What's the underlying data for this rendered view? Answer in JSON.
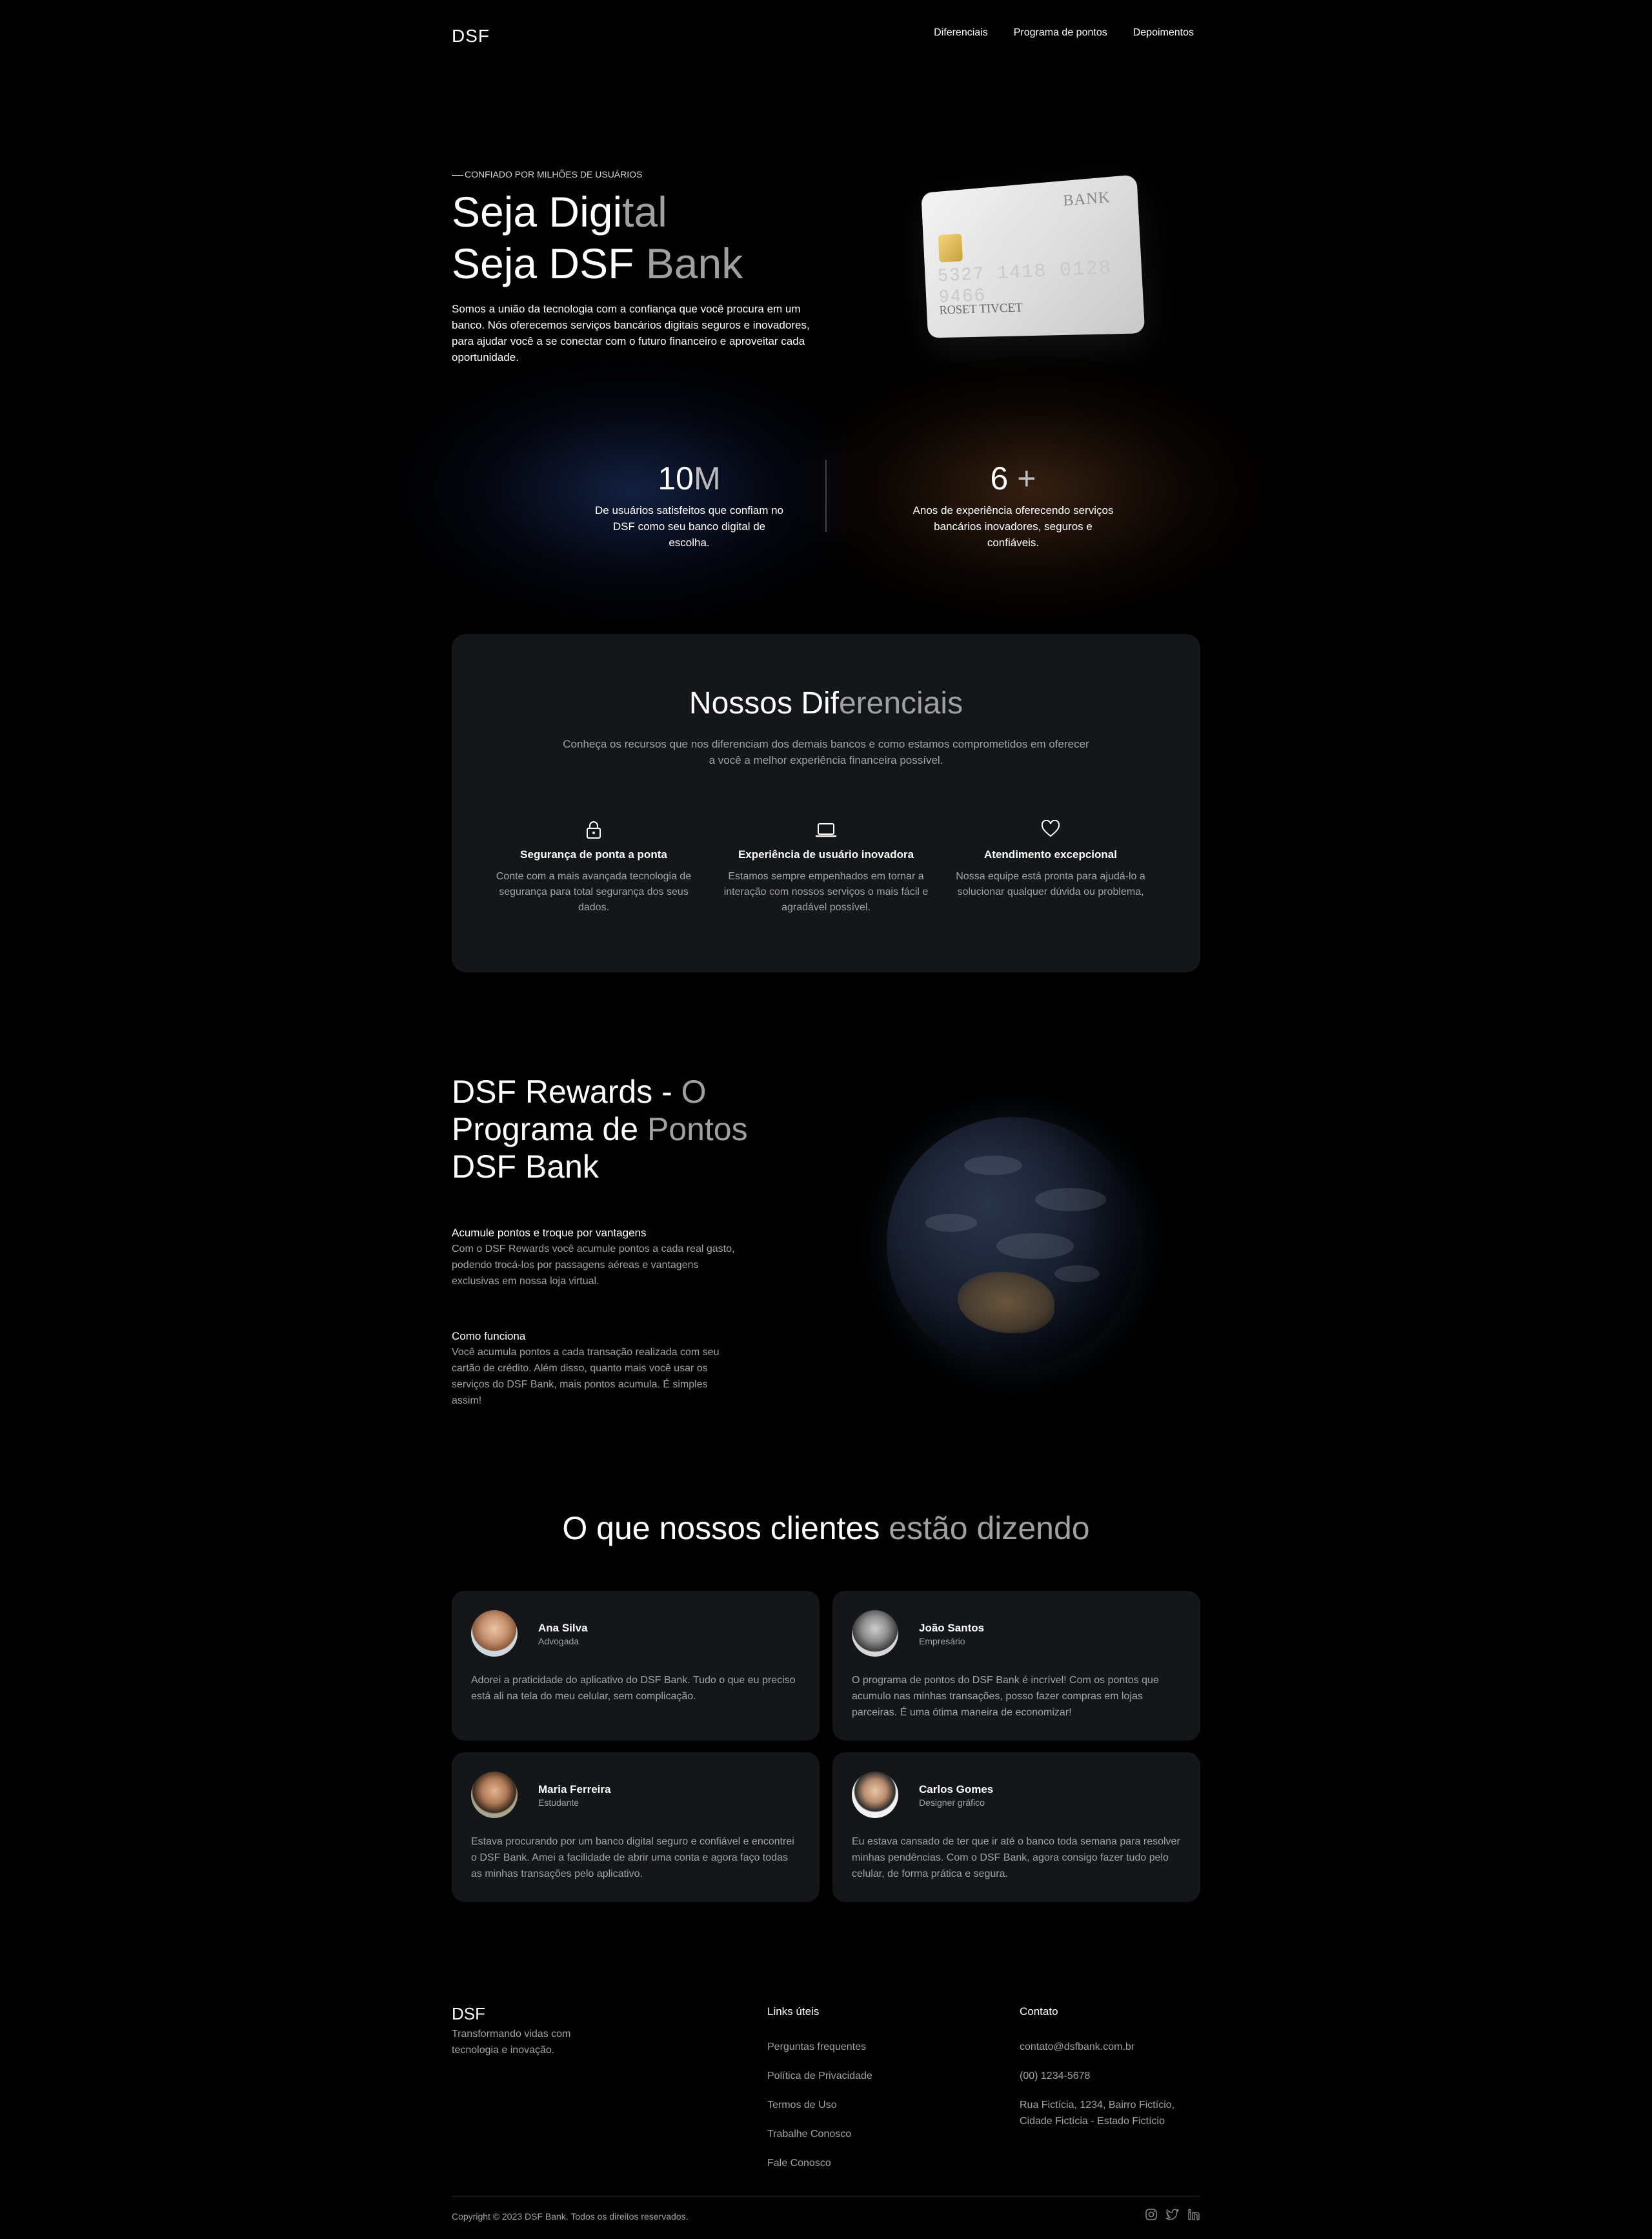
{
  "nav": {
    "logo": "DSF",
    "links": [
      "Diferenciais",
      "Programa de pontos",
      "Depoimentos"
    ]
  },
  "hero": {
    "eyebrow": "CONFIADO POR MILHÕES DE USUÁRIOS",
    "title_line1_a": "Seja Digi",
    "title_line1_b": "tal",
    "title_line2_a": "Seja DSF ",
    "title_line2_b": "Bank",
    "description": "Somos a união da tecnologia com a confiança que você procura em um banco. Nós oferecemos serviços bancários digitais seguros e inovadores, para ajudar você a se conectar com o futuro financeiro e aproveitar cada oportunidade."
  },
  "credit_card": {
    "bank": "BANK",
    "number": "5327 1418 0128 9466",
    "name": "ROSET TIVCET"
  },
  "stats": [
    {
      "value": "10",
      "suffix": "M",
      "label": "De usuários satisfeitos que confiam no DSF como seu banco digital de escolha."
    },
    {
      "value": "6",
      "suffix": " +",
      "label": "Anos de experiência oferecendo serviços bancários inovadores, seguros e confiáveis."
    }
  ],
  "diferenciais": {
    "title_a": "Nossos Dif",
    "title_b": "erenciais",
    "subtitle": "Conheça os recursos que nos diferenciam dos demais bancos e como estamos comprometidos em oferecer a você a melhor experiência financeira possível.",
    "features": [
      {
        "icon": "lock-icon",
        "title": "Segurança de ponta a ponta",
        "text": "Conte com a mais avançada tecnologia de segurança para total segurança dos seus dados."
      },
      {
        "icon": "laptop-icon",
        "title": "Experiência de usuário inovadora",
        "text": "Estamos sempre empenhados em tornar a interação com nossos serviços o mais fácil e agradável possível."
      },
      {
        "icon": "heart-icon",
        "title": "Atendimento excepcional",
        "text": "Nossa equipe está pronta para ajudá-lo a solucionar qualquer dúvida ou problema,"
      }
    ]
  },
  "rewards": {
    "title_l1_a": "DSF Rewards - ",
    "title_l1_b": "O",
    "title_l2_a": "Programa de ",
    "title_l2_b": "Pontos",
    "title_l3": "DSF Bank",
    "blocks": [
      {
        "title": "Acumule pontos e troque por vantagens",
        "text": "Com o DSF Rewards você acumule pontos a cada real gasto, podendo trocá-los por passagens aéreas e vantagens exclusivas em nossa loja virtual."
      },
      {
        "title": "Como funciona",
        "text": "Você acumula pontos a cada transação realizada com seu cartão de crédito. Além disso, quanto mais você usar os serviços do DSF Bank, mais pontos acumula. É simples assim!"
      }
    ]
  },
  "testimonials": {
    "title_a": "O que nossos clientes ",
    "title_b": "estão dizendo",
    "items": [
      {
        "name": "Ana Silva",
        "role": "Advogada",
        "text": "Adorei a praticidade do aplicativo do DSF Bank. Tudo o que eu preciso está ali na tela do meu celular, sem complicação."
      },
      {
        "name": "João Santos",
        "role": "Empresário",
        "text": "O programa de pontos do DSF Bank é incrível! Com os pontos que acumulo nas minhas transações, posso fazer compras em lojas parceiras. É uma ótima maneira de economizar!"
      },
      {
        "name": "Maria Ferreira",
        "role": "Estudante",
        "text": "Estava procurando por um banco digital seguro e confiável e encontrei o DSF Bank. Amei a facilidade de abrir uma conta e agora faço todas as minhas transações pelo aplicativo."
      },
      {
        "name": "Carlos Gomes",
        "role": "Designer gráfico",
        "text": "Eu estava cansado de ter que ir até o banco toda semana para resolver minhas pendências. Com o DSF Bank, agora consigo fazer tudo pelo celular, de forma prática e segura."
      }
    ]
  },
  "footer": {
    "logo": "DSF",
    "tagline": "Transformando vidas com tecnologia e inovação.",
    "links_title": "Links úteis",
    "links": [
      "Perguntas frequentes",
      "Política de Privacidade",
      "Termos de Uso",
      "Trabalhe Conosco",
      "Fale Conosco"
    ],
    "contact_title": "Contato",
    "contact": [
      "contato@dsfbank.com.br",
      "(00) 1234-5678",
      "Rua Fictícia, 1234, Bairro Fictício, Cidade Fictícia - Estado Fictício"
    ],
    "copyright": "Copyright © 2023 DSF Bank. Todos os direitos reservados.",
    "socials": [
      "instagram-icon",
      "twitter-icon",
      "linkedin-icon"
    ]
  }
}
